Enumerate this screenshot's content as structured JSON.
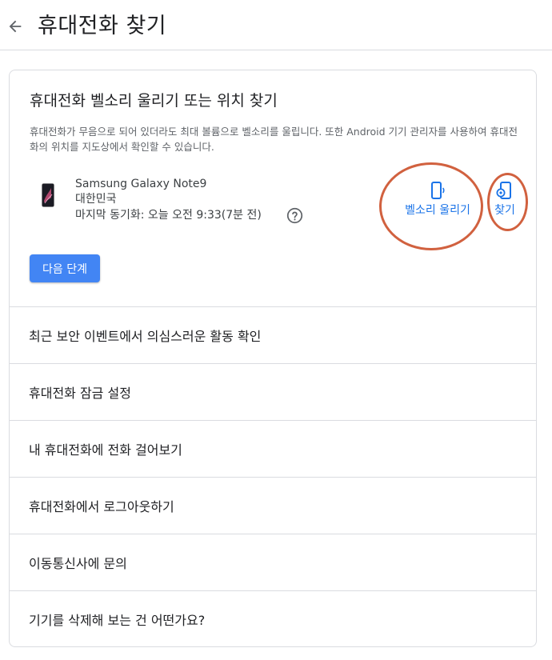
{
  "header": {
    "back_icon": "arrow-back-icon",
    "title": "휴대전화 찾기"
  },
  "card": {
    "title": "휴대전화 벨소리 울리기 또는 위치 찾기",
    "description": "휴대전화가 무음으로 되어 있더라도 최대 볼륨으로 벨소리를 울립니다. 또한 Android 기기 관리자를 사용하여 휴대전화의 위치를 지도상에서 확인할 수 있습니다.",
    "device": {
      "name": "Samsung Galaxy Note9",
      "country": "대한민국",
      "last_sync": "마지막 동기화: 오늘 오전 9:33(7분 전)"
    },
    "actions": {
      "ring_label": "벨소리 울리기",
      "ring_icon": "phone-ring-icon",
      "find_label": "찾기",
      "find_icon": "phone-locate-icon"
    },
    "next_button": "다음 단계"
  },
  "options": [
    "최근 보안 이벤트에서 의심스러운 활동 확인",
    "휴대전화 잠금 설정",
    "내 휴대전화에 전화 걸어보기",
    "휴대전화에서 로그아웃하기",
    "이동통신사에 문의",
    "기기를 삭제해 보는 건 어떤가요?"
  ],
  "colors": {
    "accent": "#1a73e8",
    "button": "#4285f4",
    "annotation": "#d1613f",
    "divider": "#dadce0"
  }
}
